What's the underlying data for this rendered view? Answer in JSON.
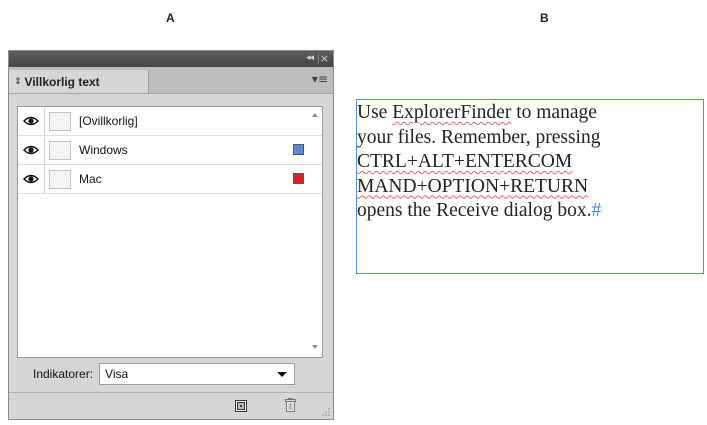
{
  "figure_labels": {
    "a": "A",
    "b": "B"
  },
  "panel": {
    "title": "Villkorlig text",
    "collapse_glyph": "◂◂",
    "close_glyph": "×",
    "menu_glyph": "▾≡",
    "conditions": [
      {
        "label": "[Ovillkorlig]",
        "visible": true,
        "color": ""
      },
      {
        "label": "Windows",
        "visible": true,
        "color": "#5b8bd6"
      },
      {
        "label": "Mac",
        "visible": true,
        "color": "#e02020"
      }
    ],
    "indicators_label": "Indikatorer:",
    "indicators_value": "Visa"
  },
  "text_frame": {
    "line1_a": "Use ",
    "line1_b": "ExplorerFinder",
    "line1_c": " to manage",
    "line2": "your files. Remember, pressing",
    "line3": "CTRL+ALT+ENTERCOM",
    "line4": "MAND+OPTION+RETURN",
    "line5": "opens the Receive dialog box.",
    "end_mark": "#"
  },
  "colors": {
    "frame_border": "#5b8bd6",
    "windows": "#5b8bd6",
    "mac": "#e02020"
  }
}
